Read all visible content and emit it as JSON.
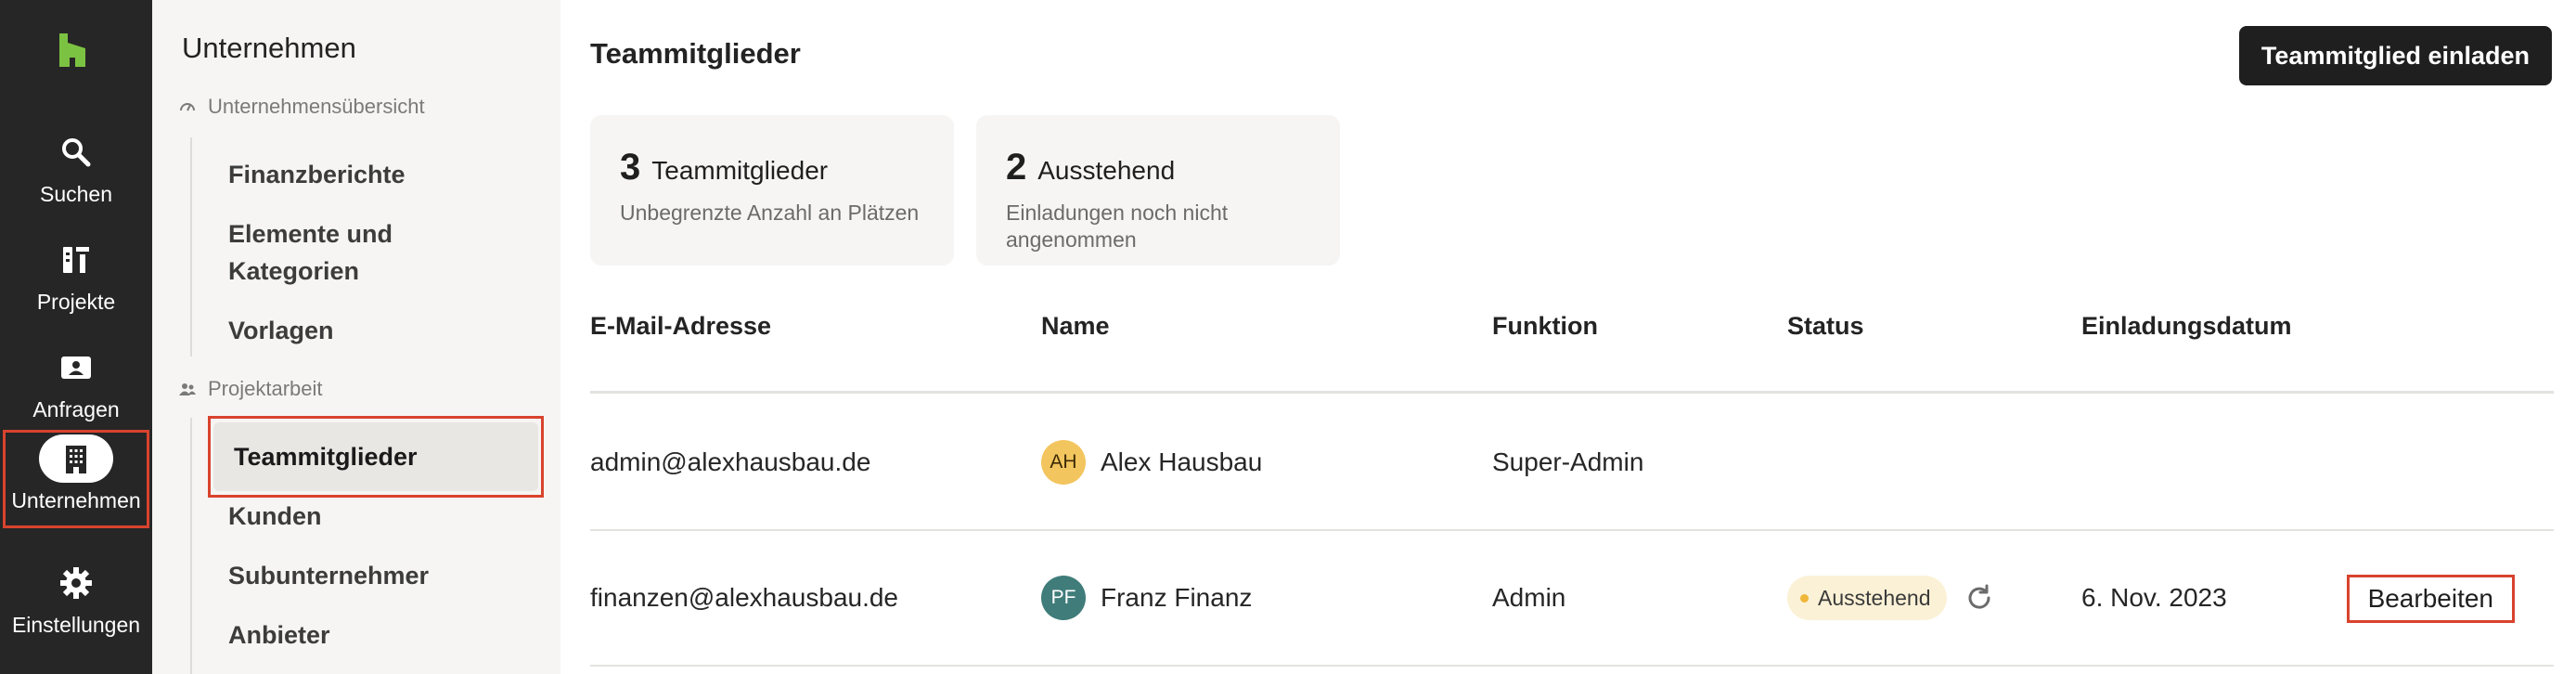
{
  "rail": {
    "items": [
      {
        "label": "Suchen",
        "icon": "search-icon"
      },
      {
        "label": "Projekte",
        "icon": "projects-icon"
      },
      {
        "label": "Anfragen",
        "icon": "inquiries-icon"
      },
      {
        "label": "Unternehmen",
        "icon": "building-icon",
        "active": true
      },
      {
        "label": "Einstellungen",
        "icon": "gear-icon"
      }
    ]
  },
  "subnav": {
    "heading": "Unternehmen",
    "section1": "Unternehmensübersicht",
    "links1": [
      "Finanzberichte",
      "Elemente und Kategorien",
      "Vorlagen"
    ],
    "section2": "Projektarbeit",
    "links2": [
      "Teammitglieder",
      "Kunden",
      "Subunternehmer",
      "Anbieter"
    ]
  },
  "main": {
    "title": "Teammitglieder",
    "invite_label": "Teammitglied einladen",
    "stats": [
      {
        "num": "3",
        "word": "Teammitglieder",
        "sub": "Unbegrenzte Anzahl an Plätzen"
      },
      {
        "num": "2",
        "word": "Ausstehend",
        "sub": "Einladungen noch nicht angenommen"
      }
    ],
    "columns": [
      "E-Mail-Adresse",
      "Name",
      "Funktion",
      "Status",
      "Einladungsdatum"
    ],
    "rows": [
      {
        "email": "admin@alexhausbau.de",
        "initials": "AH",
        "name": "Alex Hausbau",
        "role": "Super-Admin",
        "status": "",
        "date": "",
        "action": ""
      },
      {
        "email": "finanzen@alexhausbau.de",
        "initials": "PF",
        "name": "Franz Finanz",
        "role": "Admin",
        "status": "Ausstehend",
        "date": "6. Nov. 2023",
        "action": "Bearbeiten"
      }
    ]
  },
  "colors": {
    "rail_bg": "#262626",
    "brand_green": "#7cc242",
    "highlight_red": "#d9432e",
    "avatar_ah": "#f3c55e",
    "avatar_pf": "#3f7c7a"
  }
}
